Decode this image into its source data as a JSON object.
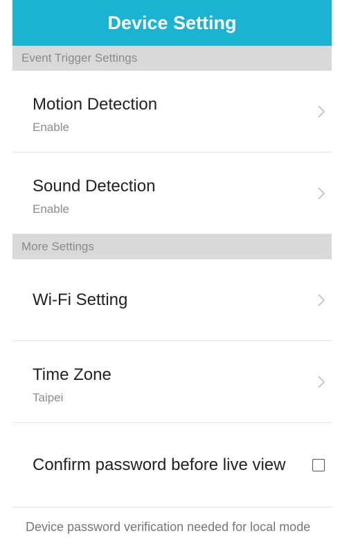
{
  "header": {
    "title": "Device Setting"
  },
  "sections": [
    {
      "title": "Event Trigger Settings",
      "items": [
        {
          "title": "Motion Detection",
          "value": "Enable"
        },
        {
          "title": "Sound Detection",
          "value": "Enable"
        }
      ]
    },
    {
      "title": "More Settings",
      "items": [
        {
          "title": "Wi-Fi Setting"
        },
        {
          "title": "Time Zone",
          "value": "Taipei"
        }
      ]
    }
  ],
  "confirm_password": {
    "label": "Confirm password before live view",
    "checked": false,
    "note": "Device password verification needed for local mode"
  },
  "colors": {
    "accent": "#1bb3d2",
    "section_bg": "#d9d9d9"
  },
  "icons": {
    "row_arrow": "chevron-right-icon",
    "toggle": "checkbox-icon"
  }
}
